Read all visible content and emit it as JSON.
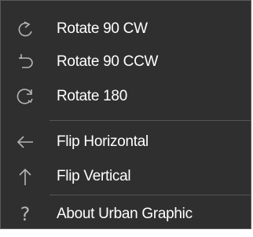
{
  "menu": {
    "items": [
      {
        "label": "Rotate 90 CW",
        "icon": "rotate-cw-icon"
      },
      {
        "label": "Rotate 90 CCW",
        "icon": "rotate-ccw-icon"
      },
      {
        "label": "Rotate 180",
        "icon": "rotate-180-icon"
      },
      {
        "label": "Flip Horizontal",
        "icon": "arrow-left-icon"
      },
      {
        "label": "Flip Vertical",
        "icon": "arrow-up-icon"
      },
      {
        "label": "About Urban Graphic",
        "icon": "help-icon",
        "glyph": "?"
      }
    ]
  },
  "colors": {
    "background": "#2f2f2f",
    "text": "#ffffff",
    "icon": "#b5b5b5",
    "separator": "#555555"
  }
}
